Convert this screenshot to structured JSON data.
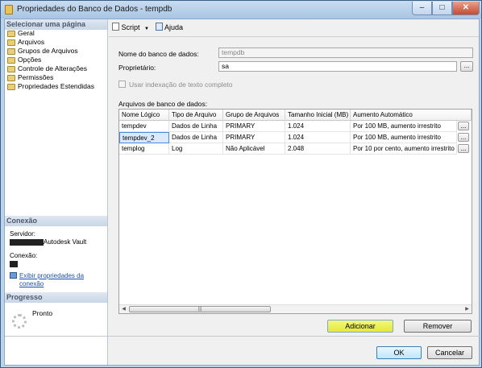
{
  "window": {
    "title": "Propriedades do Banco de Dados - tempdb",
    "min": "–",
    "max": "□",
    "close": "✕"
  },
  "left": {
    "select_page_header": "Selecionar uma página",
    "pages": [
      "Geral",
      "Arquivos",
      "Grupos de Arquivos",
      "Opções",
      "Controle de Alterações",
      "Permissões",
      "Propriedades Estendidas"
    ],
    "connection_header": "Conexão",
    "server_label": "Servidor:",
    "server_value": "Autodesk Vault",
    "connection_label": "Conexão:",
    "view_link": "Exibir propriedades da conexão",
    "progress_header": "Progresso",
    "progress_status": "Pronto"
  },
  "toolbar": {
    "script_label": "Script",
    "help_label": "Ajuda"
  },
  "form": {
    "db_name_label": "Nome do banco de dados:",
    "db_name_value": "tempdb",
    "owner_label": "Proprietário:",
    "owner_value": "sa",
    "fulltext_label": "Usar indexação de texto completo",
    "files_label": "Arquivos de banco de dados:"
  },
  "grid": {
    "columns": [
      "Nome Lógico",
      "Tipo de Arquivo",
      "Grupo de Arquivos",
      "Tamanho Inicial (MB)",
      "Aumento Automático"
    ],
    "rows": [
      [
        "tempdev",
        "Dados de Linha",
        "PRIMARY",
        "1.024",
        "Por 100 MB, aumento irrestrito"
      ],
      [
        "tempdev_2",
        "Dados de Linha",
        "PRIMARY",
        "1.024",
        "Por 100 MB, aumento irrestrito"
      ],
      [
        "templog",
        "Log",
        "Não Aplicável",
        "2.048",
        "Por 10 por cento, aumento irrestrito"
      ]
    ],
    "cell_button": "...",
    "thumb_grip": "|||"
  },
  "buttons": {
    "add": "Adicionar",
    "remove": "Remover",
    "ok": "OK",
    "cancel": "Cancelar",
    "ellipsis": "..."
  },
  "colors": {
    "highlight": "#e6ea3c",
    "link": "#1a4fb5",
    "title_bar": "#bcd3ea"
  }
}
